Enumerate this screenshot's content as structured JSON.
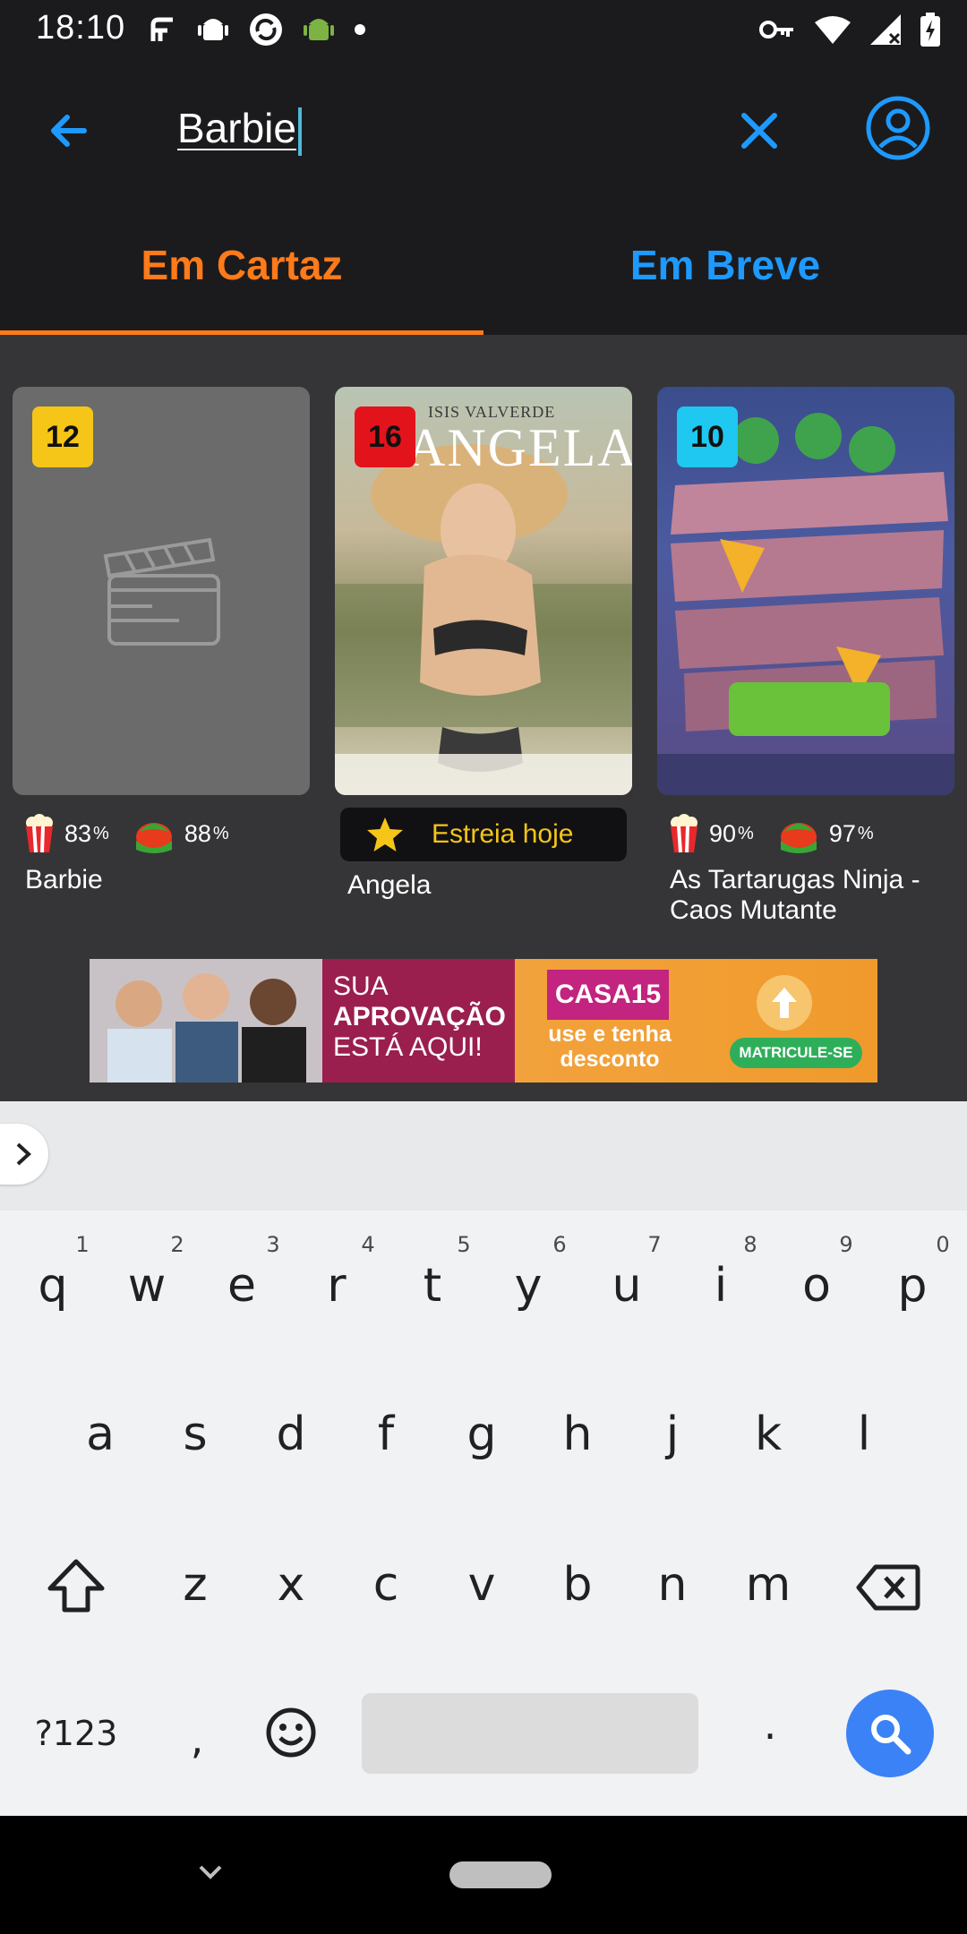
{
  "status_bar": {
    "time": "18:10"
  },
  "search": {
    "query": "Barbie"
  },
  "tabs": [
    {
      "label": "Em Cartaz"
    },
    {
      "label": "Em Breve"
    }
  ],
  "movies": [
    {
      "age_rating": "12",
      "badge_color": "#f5c518",
      "title": "Barbie",
      "audience_score": "83",
      "critic_score": "88",
      "pct_symbol": "%"
    },
    {
      "age_rating": "16",
      "badge_color": "#e3131b",
      "title": "Angela",
      "premiere_label": "Estreia hoje",
      "poster_text": "ANGELA",
      "poster_actor": "ISIS VALVERDE"
    },
    {
      "age_rating": "10",
      "badge_color": "#1ec8f0",
      "title": "As Tartarugas Ninja - Caos Mutante",
      "audience_score": "90",
      "critic_score": "97",
      "pct_symbol": "%"
    }
  ],
  "banner": {
    "line1": "SUA",
    "line2": "APROVAÇÃO",
    "line3": "ESTÁ AQUI!",
    "code": "CASA15",
    "promo": "use e tenha desconto",
    "cta": "MATRICULE-SE"
  },
  "keyboard": {
    "row1": [
      "q",
      "w",
      "e",
      "r",
      "t",
      "y",
      "u",
      "i",
      "o",
      "p"
    ],
    "row1_hints": [
      "1",
      "2",
      "3",
      "4",
      "5",
      "6",
      "7",
      "8",
      "9",
      "0"
    ],
    "row2": [
      "a",
      "s",
      "d",
      "f",
      "g",
      "h",
      "j",
      "k",
      "l"
    ],
    "row3": [
      "z",
      "x",
      "c",
      "v",
      "b",
      "n",
      "m"
    ],
    "symbols_key": "?123",
    "comma": ",",
    "period": "."
  }
}
